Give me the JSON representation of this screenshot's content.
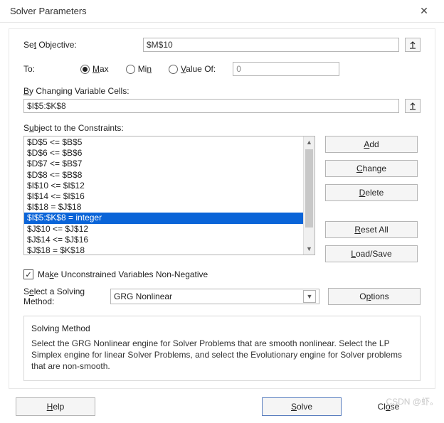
{
  "title": "Solver Parameters",
  "objective": {
    "label": "Set Objective:",
    "value": "$M$10"
  },
  "to": {
    "label": "To:",
    "max": "Max",
    "min": "Min",
    "valueof": "Value Of:",
    "valueof_value": "0",
    "selected": "max"
  },
  "changing": {
    "label": "By Changing Variable Cells:",
    "value": "$I$5:$K$8"
  },
  "constraints": {
    "label": "Subject to the Constraints:",
    "items": [
      "$D$5 <= $B$5",
      "$D$6 <= $B$6",
      "$D$7 <= $B$7",
      "$D$8 <= $B$8",
      "$I$10 <= $I$12",
      "$I$14 <= $I$16",
      "$I$18 = $J$18",
      "$I$5:$K$8 = integer",
      "$J$10 <= $J$12",
      "$J$14 <= $J$16",
      "$J$18 = $K$18"
    ],
    "selected_index": 7
  },
  "buttons": {
    "add": "Add",
    "change": "Change",
    "delete": "Delete",
    "resetall": "Reset All",
    "loadsave": "Load/Save",
    "options": "Options",
    "help": "Help",
    "solve": "Solve",
    "close": "Close"
  },
  "nonneg": {
    "checked": true,
    "label": "Make Unconstrained Variables Non-Negative"
  },
  "method": {
    "label": "Select a Solving Method:",
    "value": "GRG Nonlinear"
  },
  "desc": {
    "title": "Solving Method",
    "body": "Select the GRG Nonlinear engine for Solver Problems that are smooth nonlinear. Select the LP Simplex engine for linear Solver Problems, and select the Evolutionary engine for Solver problems that are non-smooth."
  },
  "watermark": "CSDN @虾。"
}
